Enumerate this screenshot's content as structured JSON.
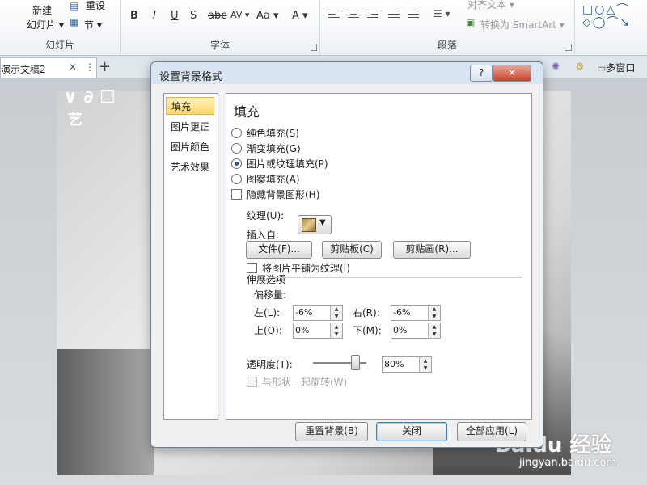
{
  "ribbon": {
    "slides_group": {
      "new_slide": "新建",
      "new_slide_sub": "幻灯片 ▾",
      "reset": "重设",
      "section": "节 ▾",
      "label": "幻灯片"
    },
    "font_group": {
      "label": "字体",
      "bold": "B",
      "italic": "I",
      "underline": "U",
      "shadow": "S",
      "strike": "abc",
      "spacing": "AV ▾",
      "case": "Aa ▾",
      "color": "A ▾"
    },
    "para_group": {
      "label": "段落",
      "align_text": "对齐文本 ▾",
      "smartart": "转换为 SmartArt ▾"
    }
  },
  "tabbar": {
    "doc_tab": "演示文稿2",
    "close": "✕",
    "more": "⋮",
    "plus": "+",
    "multiwin": "多窗口"
  },
  "slide": {
    "char1": "艺",
    "char2": "∨ ∂ ☐"
  },
  "watermark": {
    "brand": "Baidu 经验",
    "url": "jingyan.baidu.com"
  },
  "dialog": {
    "title": "设置背景格式",
    "help": "?",
    "close": "✕",
    "nav": [
      "填充",
      "图片更正",
      "图片颜色",
      "艺术效果"
    ],
    "panel": {
      "title": "填充",
      "radios": [
        "纯色填充(S)",
        "渐变填充(G)",
        "图片或纹理填充(P)",
        "图案填充(A)"
      ],
      "hide_bg": "隐藏背景图形(H)",
      "texture_label": "纹理(U):",
      "insert_from": "插入自:",
      "btn_file": "文件(F)...",
      "btn_clipboard": "剪贴板(C)",
      "btn_clipart": "剪贴画(R)...",
      "tile_label": "将图片平铺为纹理(I)",
      "stretch_label": "伸展选项",
      "offset_label": "偏移量:",
      "left_label": "左(L):",
      "left_val": "-6%",
      "right_label": "右(R):",
      "right_val": "-6%",
      "top_label": "上(O):",
      "top_val": "0%",
      "bottom_label": "下(M):",
      "bottom_val": "0%",
      "transparency_label": "透明度(T):",
      "transparency_val": "80%",
      "transparency_level": 0.8,
      "rotate_label": "与形状一起旋转(W)"
    },
    "footer": {
      "reset": "重置背景(B)",
      "close": "关闭",
      "apply_all": "全部应用(L)"
    }
  }
}
